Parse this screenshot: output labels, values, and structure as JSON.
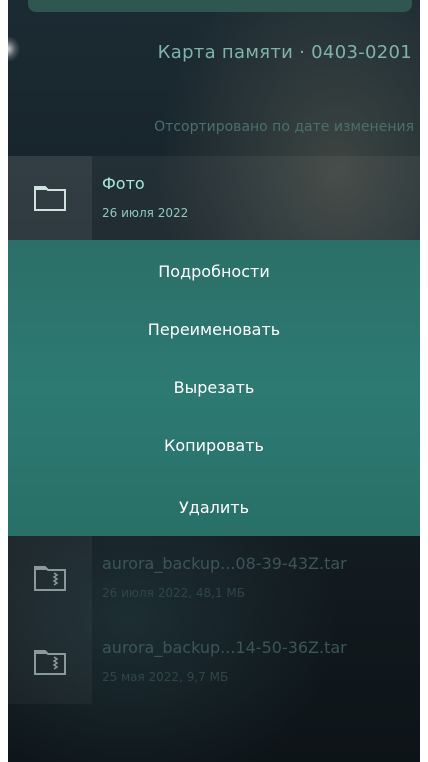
{
  "header": {
    "title": "Карта памяти · 0403-0201",
    "sort_label": "Отсортировано по дате изменения"
  },
  "selected_item": {
    "name": "Фото",
    "meta": "26 июля 2022",
    "icon": "folder-icon"
  },
  "context_menu": {
    "items": [
      {
        "label": "Подробности"
      },
      {
        "label": "Переименовать"
      },
      {
        "label": "Вырезать"
      },
      {
        "label": "Копировать"
      },
      {
        "label": "Удалить"
      }
    ]
  },
  "files": [
    {
      "name": "aurora_backup...08-39-43Z.tar",
      "meta": "26 июля 2022, 48,1 МБ",
      "icon": "archive-folder-icon"
    },
    {
      "name": "aurora_backup...14-50-36Z.tar",
      "meta": "25 мая 2022, 9,7 МБ",
      "icon": "archive-folder-icon"
    }
  ],
  "colors": {
    "accent": "#7fb3ab",
    "menu_background": "#2b6f68",
    "selected_text": "#a6e8df"
  }
}
